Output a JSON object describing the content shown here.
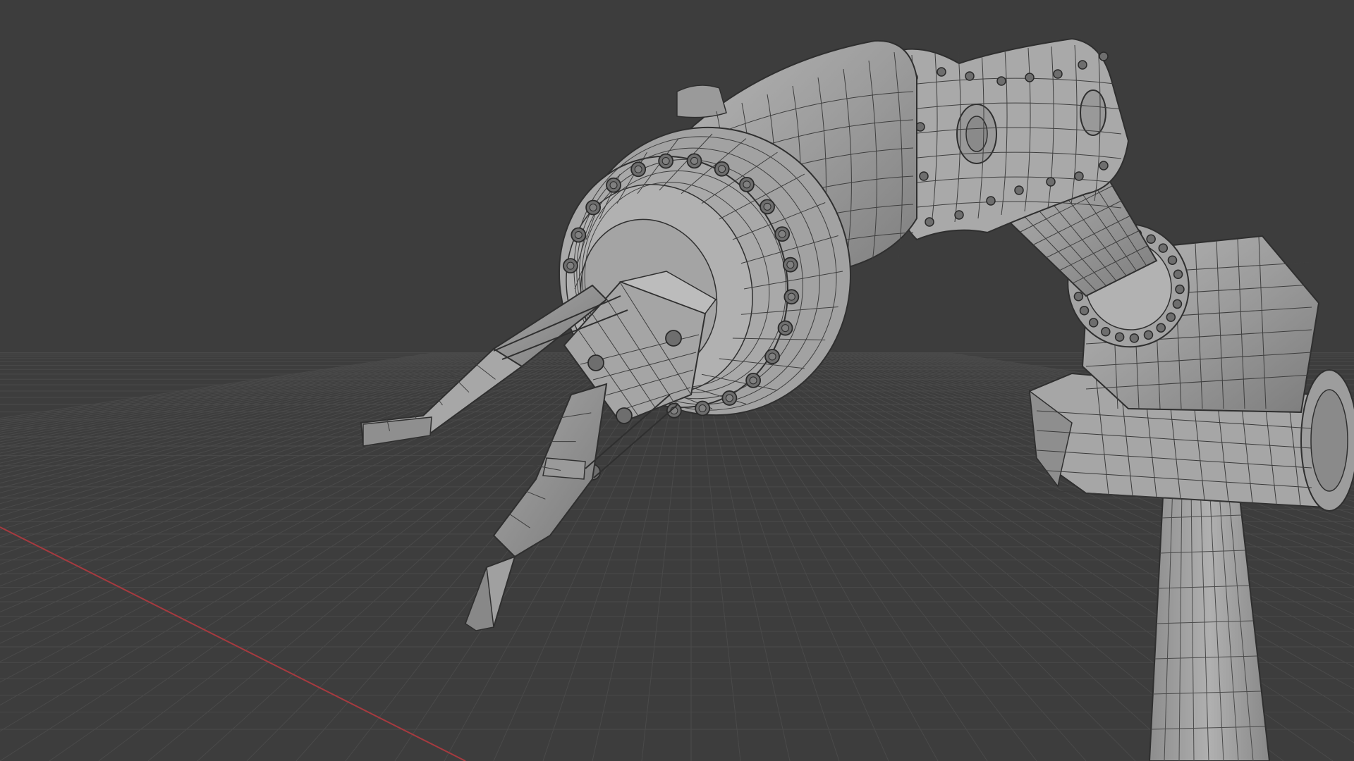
{
  "viewport": {
    "view_mode": "3D viewport",
    "shading": "solid-wireframe",
    "background_color": "#3d3d3d",
    "grid_color": "#4a4a4a",
    "x_axis_color": "#a63a3f"
  },
  "scene": {
    "object": "robotic-arm",
    "object_color": "#9a9a9a",
    "wire_color": "#2a2a2a",
    "bolt_color": "#6e6e6e"
  },
  "icons": {
    "viewport": "3d-viewport-icon"
  }
}
